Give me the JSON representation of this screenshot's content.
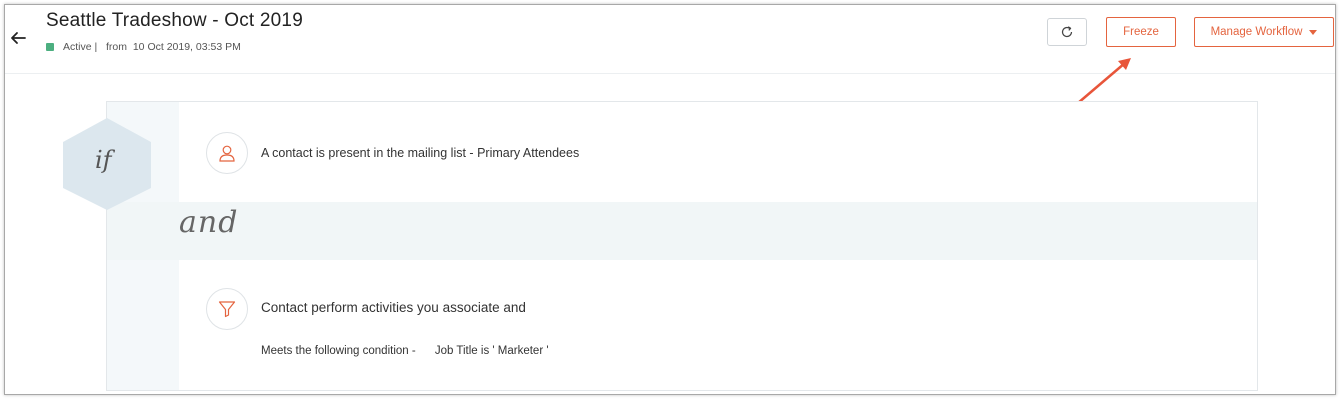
{
  "header": {
    "title": "Seattle Tradeshow - Oct 2019",
    "status": "Active",
    "status_sep": " |   ",
    "from_label": "from",
    "from_date": "10 Oct 2019, 03:53 PM",
    "status_color": "#4caf80"
  },
  "toolbar": {
    "refresh_icon": "refresh-icon",
    "freeze_label": "Freeze",
    "manage_label": "Manage Workflow",
    "accent_color": "#e4643f"
  },
  "workflow": {
    "if_label": "if",
    "and_label": "and",
    "conditions": [
      {
        "icon": "contact-icon",
        "text": "A contact is present in the mailing list - Primary Attendees"
      },
      {
        "icon": "funnel-icon",
        "text": "Contact perform activities you associate and",
        "detail_prefix": "Meets the following condition -",
        "detail_value": "Job Title is ' Marketer '"
      }
    ]
  }
}
